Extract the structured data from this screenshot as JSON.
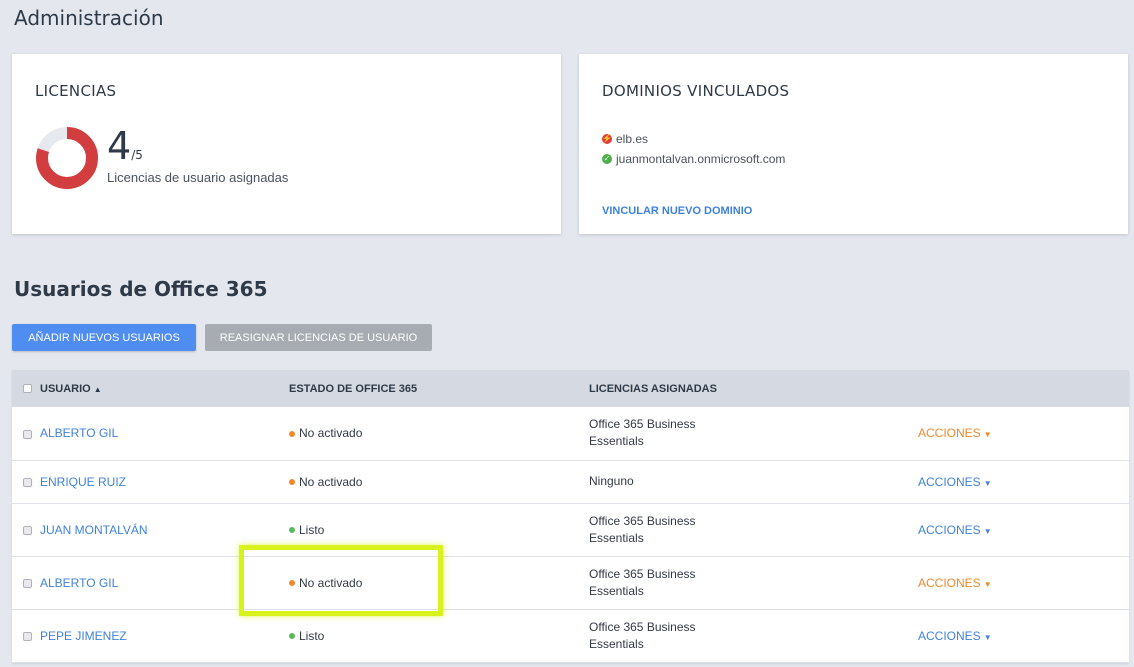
{
  "page": {
    "title": "Administración"
  },
  "licencias": {
    "title": "LICENCIAS",
    "assigned": "4",
    "total": "/5",
    "caption": "Licencias de usuario asignadas",
    "fraction_assigned": 0.8,
    "colors": {
      "assigned": "#d23d3f",
      "free": "#e6e9ee"
    }
  },
  "dominios": {
    "title": "DOMINIOS VINCULADOS",
    "items": [
      {
        "name": "elb.es",
        "status_icon": "error-icon",
        "color": "#e23b3b"
      },
      {
        "name": "juanmontalvan.onmicrosoft.com",
        "status_icon": "check-circle-icon",
        "color": "#4fb04b"
      }
    ],
    "link": "VINCULAR NUEVO DOMINIO"
  },
  "usuarios": {
    "title": "Usuarios de Office 365",
    "buttons": {
      "add": "AÑADIR NUEVOS USUARIOS",
      "reassign": "REASIGNAR LICENCIAS DE USUARIO"
    },
    "columns": {
      "usuario": "USUARIO",
      "estado": "ESTADO DE OFFICE 365",
      "licencias": "LICENCIAS ASIGNADAS"
    },
    "rows": [
      {
        "name": "ALBERTO GIL",
        "status": "No activado",
        "status_color": "#f0892b",
        "license_lines": [
          "Office 365 Business",
          "Essentials"
        ],
        "actions": "ACCIONES",
        "actions_color": "#f0892b"
      },
      {
        "name": "ENRIQUE RUIZ",
        "status": "No activado",
        "status_color": "#f0892b",
        "license_lines": [
          "Ninguno"
        ],
        "actions": "ACCIONES",
        "actions_color": "#3f82d9"
      },
      {
        "name": "JUAN MONTALVÁN",
        "status": "Listo",
        "status_color": "#5cb85c",
        "license_lines": [
          "Office 365 Business",
          "Essentials"
        ],
        "actions": "ACCIONES",
        "actions_color": "#3f82d9"
      },
      {
        "name": "ALBERTO GIL",
        "status": "No activado",
        "status_color": "#f0892b",
        "license_lines": [
          "Office 365 Business",
          "Essentials"
        ],
        "actions": "ACCIONES",
        "actions_color": "#f0892b"
      },
      {
        "name": "PEPE JIMENEZ",
        "status": "Listo",
        "status_color": "#5cb85c",
        "license_lines": [
          "Office 365 Business",
          "Essentials"
        ],
        "actions": "ACCIONES",
        "actions_color": "#3f82d9"
      }
    ]
  },
  "highlight": {
    "color": "#d8f21c",
    "target": "row-4-status"
  }
}
